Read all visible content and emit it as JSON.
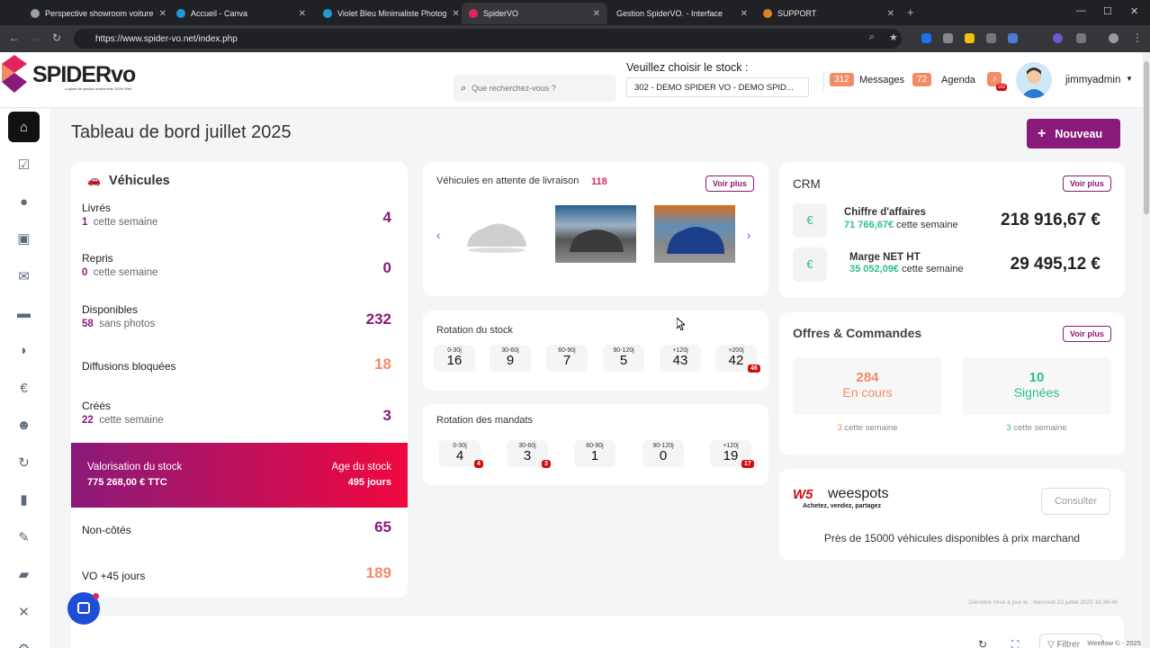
{
  "browser": {
    "tabs": [
      {
        "title": "Perspective showroom voiture"
      },
      {
        "title": "Accueil - Canva"
      },
      {
        "title": "Violet Bleu Minimaliste Photog"
      },
      {
        "title": "SpiderVO"
      },
      {
        "title": "Gestion SpiderVO. - Interface"
      },
      {
        "title": "SUPPORT"
      }
    ],
    "url": "https://www.spider-vo.net/index.php"
  },
  "header": {
    "logo_text": "SPIDERvo",
    "logo_tagline": "Logiciel de gestion automobile 100% Web",
    "search_placeholder": "Que recherchez-vous ?",
    "stock_label": "Veuillez choisir le stock :",
    "stock_value": "302 - DEMO SPIDER VO - DEMO SPID...",
    "messages_count": "312",
    "messages_label": "Messages",
    "agenda_count": "72",
    "agenda_label": "Agenda",
    "notif_count": "262",
    "username": "jimmyadmin"
  },
  "sidebar": {
    "items": [
      {
        "name": "home",
        "icon": "⌂"
      },
      {
        "name": "calendar",
        "icon": "☑"
      },
      {
        "name": "user",
        "icon": "●"
      },
      {
        "name": "briefcase",
        "icon": "▣"
      },
      {
        "name": "mail",
        "icon": "✉"
      },
      {
        "name": "car",
        "icon": "▬"
      },
      {
        "name": "piggy-bank",
        "icon": "◗"
      },
      {
        "name": "euro",
        "icon": "€"
      },
      {
        "name": "users",
        "icon": "☻"
      },
      {
        "name": "sync",
        "icon": "↻"
      },
      {
        "name": "chart",
        "icon": "▮"
      },
      {
        "name": "wrench",
        "icon": "✎"
      },
      {
        "name": "truck",
        "icon": "▰"
      },
      {
        "name": "tools",
        "icon": "✕"
      },
      {
        "name": "settings",
        "icon": "⚙"
      }
    ]
  },
  "page": {
    "title": "Tableau de bord juillet 2025",
    "new_button": "Nouveau",
    "last_update": "Dernière mise à jour le : mercredi 23 juillet 2025 16:36:46"
  },
  "vehicules": {
    "title": "Véhicules",
    "rows": [
      {
        "label": "Livrés",
        "sub_num": "1",
        "sub_text": "cette semaine",
        "value": "4",
        "color": "purple"
      },
      {
        "label": "Repris",
        "sub_num": "0",
        "sub_text": "cette semaine",
        "value": "0",
        "color": "purple"
      },
      {
        "label": "Disponibles",
        "sub_num": "58",
        "sub_text": "sans photos",
        "value": "232",
        "color": "purple"
      },
      {
        "label": "Diffusions bloquées",
        "sub_num": "",
        "sub_text": "",
        "value": "18",
        "color": "orange"
      },
      {
        "label": "Créés",
        "sub_num": "22",
        "sub_text": "cette semaine",
        "value": "3",
        "color": "purple"
      }
    ],
    "valo_label": "Valorisation du stock",
    "valo_value": "775 268,00 € TTC",
    "age_label": "Age du stock",
    "age_value": "495 jours",
    "noncotes_label": "Non-côtés",
    "noncotes_value": "65",
    "vo45_label": "VO +45 jours",
    "vo45_value": "189"
  },
  "livraison": {
    "title": "Véhicules en attente de livraison",
    "count": "118",
    "voir": "Voir plus"
  },
  "rotation_stock": {
    "title": "Rotation du stock",
    "items": [
      {
        "range": "0-30j",
        "value": "16",
        "badge": ""
      },
      {
        "range": "30-60j",
        "value": "9",
        "badge": ""
      },
      {
        "range": "60-90j",
        "value": "7",
        "badge": ""
      },
      {
        "range": "90-120j",
        "value": "5",
        "badge": ""
      },
      {
        "range": "+120j",
        "value": "43",
        "badge": ""
      },
      {
        "range": "+200j",
        "value": "42",
        "badge": "46"
      }
    ]
  },
  "rotation_mandats": {
    "title": "Rotation des mandats",
    "items": [
      {
        "range": "0-30j",
        "value": "4",
        "badge": "4"
      },
      {
        "range": "30-60j",
        "value": "3",
        "badge": "3"
      },
      {
        "range": "60-90j",
        "value": "1",
        "badge": ""
      },
      {
        "range": "90-120j",
        "value": "0",
        "badge": ""
      },
      {
        "range": "+120j",
        "value": "19",
        "badge": "17"
      }
    ]
  },
  "crm": {
    "title": "CRM",
    "voir": "Voir plus",
    "ca_label": "Chiffre d'affaires",
    "ca_week_value": "71 766,67€",
    "ca_week_text": "cette semaine",
    "ca_total": "218 916,67 €",
    "marge_label": "Marge NET HT",
    "marge_week_value": "35 052,09€",
    "marge_week_text": "cette semaine",
    "marge_total": "29 495,12 €"
  },
  "offres": {
    "title": "Offres & Commandes",
    "voir": "Voir plus",
    "encours_value": "284",
    "encours_label": "En cours",
    "signees_value": "10",
    "signees_label": "Signées",
    "encours_week_num": "3",
    "encours_week_text": "cette semaine",
    "signees_week_num": "3",
    "signees_week_text": "cette semaine"
  },
  "weespots": {
    "logo": "weespots",
    "tagline": "Achetez, vendez, partagez",
    "button": "Consulter",
    "text": "Près de 15000 véhicules disponibles à prix marchand"
  },
  "bottom": {
    "filter_label": "Filtrer",
    "footer": "Weeflow © - 2025"
  },
  "colors": {
    "brand_purple": "#8a1a7a",
    "orange": "#f28b66",
    "green": "#2bbf8a",
    "badge_red": "#d30d0d"
  }
}
